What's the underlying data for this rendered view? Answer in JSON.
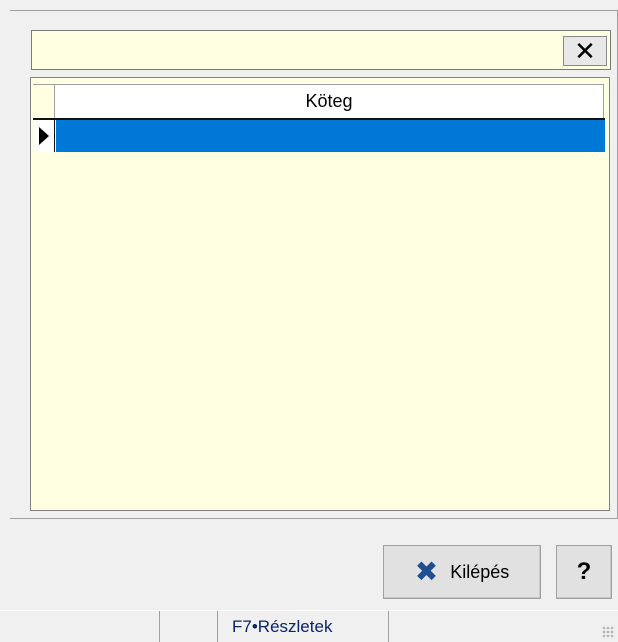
{
  "search": {
    "value": "",
    "placeholder": ""
  },
  "clear_button": {
    "icon": "close-icon",
    "glyph": "✕"
  },
  "grid": {
    "columns": [
      "Köteg"
    ],
    "rows": [
      {
        "selected": true,
        "cells": [
          ""
        ]
      }
    ],
    "selection_color": "#0078d7",
    "background_color": "#ffffe1"
  },
  "buttons": {
    "exit_label": "Kilépés",
    "exit_icon": "x-icon",
    "exit_glyph": "✖",
    "help_label": "?"
  },
  "statusbar": {
    "key": "F7",
    "separator": "•",
    "label": "Részletek"
  }
}
